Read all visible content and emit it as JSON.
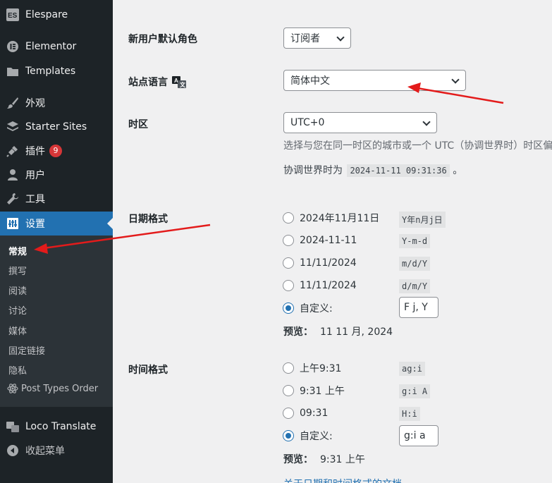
{
  "sidebar": {
    "items": [
      {
        "label": "Elespare",
        "icon": "elespare-logo-icon"
      },
      {
        "label": "Elementor",
        "icon": "elementor-icon"
      },
      {
        "label": "Templates",
        "icon": "folder-icon"
      },
      {
        "label": "外观",
        "icon": "paintbrush-icon"
      },
      {
        "label": "Starter Sites",
        "icon": "starter-sites-icon"
      },
      {
        "label": "插件",
        "icon": "plugin-icon",
        "badge": "9"
      },
      {
        "label": "用户",
        "icon": "user-icon"
      },
      {
        "label": "工具",
        "icon": "wrench-icon"
      },
      {
        "label": "设置",
        "icon": "settings-icon"
      }
    ],
    "submenu": [
      "常规",
      "撰写",
      "阅读",
      "讨论",
      "媒体",
      "固定链接",
      "隐私",
      "Post Types Order"
    ],
    "bottom": [
      {
        "label": "Loco Translate",
        "icon": "translate-icon"
      },
      {
        "label": "收起菜单",
        "icon": "collapse-icon"
      }
    ]
  },
  "settings": {
    "default_role": {
      "label": "新用户默认角色",
      "value": "订阅者"
    },
    "site_language": {
      "label": "站点语言",
      "value": "简体中文"
    },
    "timezone": {
      "label": "时区",
      "value": "UTC+0",
      "description": "选择与您在同一时区的城市或一个 UTC（协调世界时）时区偏移",
      "utc_prefix": "协调世界时为",
      "utc_time": "2024-11-11 09:31:36",
      "utc_suffix": "。"
    },
    "date_format": {
      "label": "日期格式",
      "options": [
        {
          "label": "2024年11月11日",
          "code": "Y年n月j日",
          "checked": false
        },
        {
          "label": "2024-11-11",
          "code": "Y-m-d",
          "checked": false
        },
        {
          "label": "11/11/2024",
          "code": "m/d/Y",
          "checked": false
        },
        {
          "label": "11/11/2024",
          "code": "d/m/Y",
          "checked": false
        },
        {
          "label": "自定义:",
          "checked": true
        }
      ],
      "custom_value": "F j, Y",
      "preview_label": "预览：",
      "preview_value": "11 11 月, 2024"
    },
    "time_format": {
      "label": "时间格式",
      "options": [
        {
          "label": "上午9:31",
          "code": "ag:i",
          "checked": false
        },
        {
          "label": "9:31 上午",
          "code": "g:i A",
          "checked": false
        },
        {
          "label": "09:31",
          "code": "H:i",
          "checked": false
        },
        {
          "label": "自定义:",
          "checked": true
        }
      ],
      "custom_value": "g:i a",
      "preview_label": "预览：",
      "preview_value": "9:31 上午"
    },
    "doc_link": "关于日期和时间格式的文档"
  },
  "colors": {
    "sidebar_bg": "#1d2327",
    "submenu_bg": "#2c3338",
    "accent": "#2271b1",
    "badge": "#d63638",
    "annotation_arrow": "#e31b1b"
  }
}
